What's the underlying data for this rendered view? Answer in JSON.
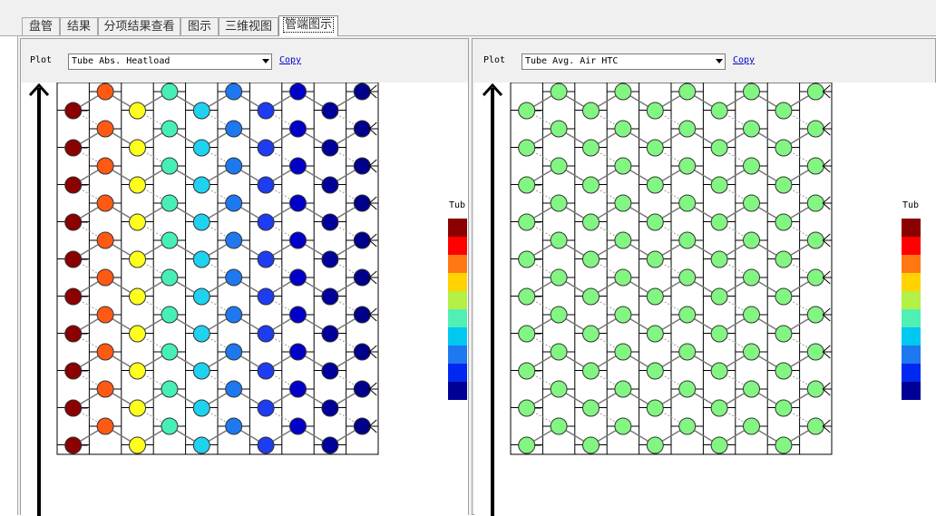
{
  "tabs": [
    {
      "label": "盘管"
    },
    {
      "label": "结果"
    },
    {
      "label": "分项结果查看"
    },
    {
      "label": "图示"
    },
    {
      "label": "三维视图"
    },
    {
      "label": "管端图示",
      "active": true
    }
  ],
  "left_panel": {
    "plot_label": "Plot",
    "selected_plot": "Tube Abs. Heatload",
    "copy_label": "Copy",
    "legend_title": "Tub",
    "column_colors": [
      "#8b0000",
      "#ff5a14",
      "#ffff1e",
      "#46f0b4",
      "#1ed2f0",
      "#1e78f0",
      "#1e3cf0",
      "#0000c8",
      "#00009a",
      "#00008b"
    ]
  },
  "right_panel": {
    "plot_label": "Plot",
    "selected_plot": "Tube Avg. Air HTC",
    "copy_label": "Copy",
    "legend_title": "Tub",
    "tube_color": "#82f582"
  },
  "legend_colors": [
    "#8b0000",
    "#ff0000",
    "#ff7814",
    "#ffd200",
    "#b4f046",
    "#50f0b4",
    "#00c8f0",
    "#1e78f0",
    "#0028f0",
    "#000096"
  ]
}
